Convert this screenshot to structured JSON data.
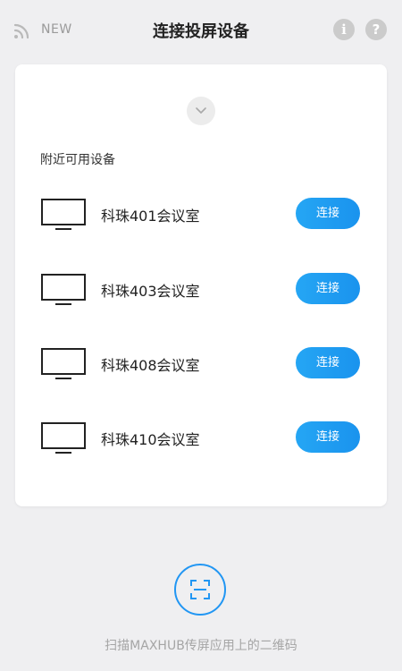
{
  "header": {
    "new_label": "NEW",
    "title": "连接投屏设备",
    "info_glyph": "i",
    "help_glyph": "?"
  },
  "card": {
    "section_label": "附近可用设备",
    "devices": [
      {
        "name": "科珠401会议室",
        "connect_label": "连接"
      },
      {
        "name": "科珠403会议室",
        "connect_label": "连接"
      },
      {
        "name": "科珠408会议室",
        "connect_label": "连接"
      },
      {
        "name": "科珠410会议室",
        "connect_label": "连接"
      }
    ]
  },
  "footer": {
    "scan_hint": "扫描MAXHUB传屏应用上的二维码"
  },
  "colors": {
    "accent": "#1e9bf0",
    "background": "#efeff1",
    "card": "#ffffff",
    "muted_icon": "#cbcbcb"
  },
  "icons": [
    "wifi-icon",
    "info-icon",
    "help-icon",
    "chevron-down-icon",
    "monitor-icon",
    "scan-icon"
  ]
}
